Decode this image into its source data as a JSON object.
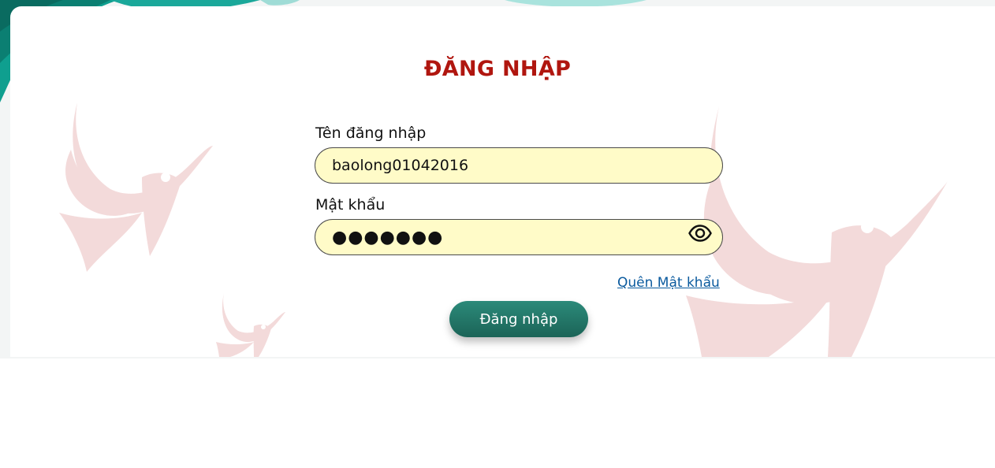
{
  "login": {
    "title": "ĐĂNG NHẬP",
    "username": {
      "label": "Tên đăng nhập",
      "value": "baolong01042016"
    },
    "password": {
      "label": "Mật khẩu",
      "value": "●●●●●●●",
      "toggle_icon": "eye-icon"
    },
    "forgot_password": "Quên Mật khẩu",
    "submit_label": "Đăng nhập"
  },
  "colors": {
    "title": "#b0160f",
    "input_background": "#fffbc8",
    "button": "#1f6f62",
    "link": "#0a5a9e",
    "teal_decor": "#1aa89a",
    "watermark": "#f2d4d4"
  }
}
